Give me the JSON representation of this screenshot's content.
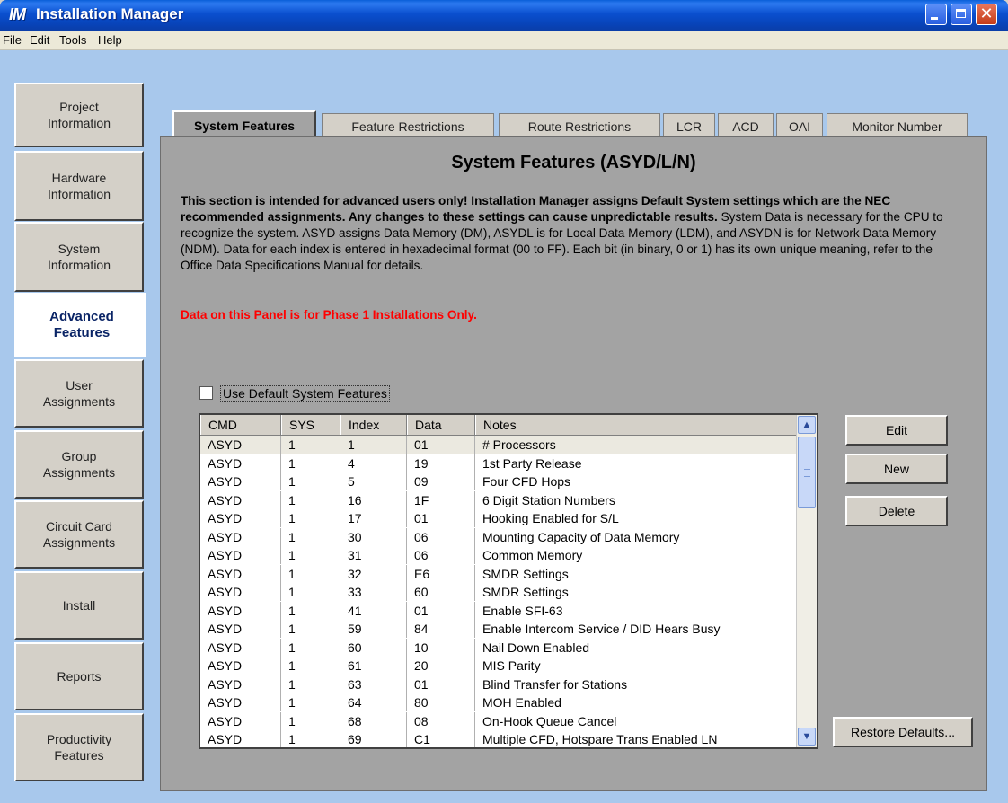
{
  "window": {
    "app_icon": "IM",
    "title": "Installation Manager",
    "buttons": [
      "minimize-icon",
      "maximize-icon",
      "close-icon"
    ]
  },
  "menu": [
    "File",
    "Edit",
    "Tools",
    "Help"
  ],
  "sidebar": {
    "items": [
      {
        "label": "Project\nInformation"
      },
      {
        "label": "Hardware\nInformation"
      },
      {
        "label": "System\nInformation"
      },
      {
        "label": "Advanced\nFeatures",
        "active": true
      },
      {
        "label": "User\nAssignments"
      },
      {
        "label": "Group\nAssignments"
      },
      {
        "label": "Circuit Card\nAssignments"
      },
      {
        "label": "Install"
      },
      {
        "label": "Reports"
      },
      {
        "label": "Productivity\nFeatures"
      }
    ]
  },
  "tabs": [
    {
      "label": "System Features",
      "active": true
    },
    {
      "label": "Feature Restrictions"
    },
    {
      "label": "Route Restrictions"
    },
    {
      "label": "LCR"
    },
    {
      "label": "ACD"
    },
    {
      "label": "OAI"
    },
    {
      "label": "Monitor Number"
    }
  ],
  "panel": {
    "heading": "System Features (ASYD/L/N)",
    "desc_bold": "This section is intended for advanced users only! Installation Manager assigns Default System settings which are the NEC recommended assignments. Any changes to these settings can cause unpredictable results.",
    "desc_normal": " System Data is necessary for the CPU to recognize the system. ASYD assigns Data Memory (DM), ASYDL is for Local Data Memory (LDM), and ASYDN is for Network Data Memory (NDM). Data for each index is entered in hexadecimal format (00 to FF). Each bit (in binary, 0 or 1) has its own unique meaning, refer to the Office Data Specifications Manual for details.",
    "warning": "Data on this Panel is for Phase 1 Installations Only.",
    "checkbox_label": "Use Default System Features",
    "checkbox_checked": false
  },
  "grid": {
    "columns": [
      "CMD",
      "SYS",
      "Index",
      "Data",
      "Notes"
    ],
    "rows": [
      [
        "ASYD",
        "1",
        "1",
        "01",
        "# Processors"
      ],
      [
        "ASYD",
        "1",
        "4",
        "19",
        "1st Party Release"
      ],
      [
        "ASYD",
        "1",
        "5",
        "09",
        "Four CFD Hops"
      ],
      [
        "ASYD",
        "1",
        "16",
        "1F",
        "6 Digit Station Numbers"
      ],
      [
        "ASYD",
        "1",
        "17",
        "01",
        "Hooking Enabled for S/L"
      ],
      [
        "ASYD",
        "1",
        "30",
        "06",
        "Mounting Capacity of Data Memory"
      ],
      [
        "ASYD",
        "1",
        "31",
        "06",
        "Common Memory"
      ],
      [
        "ASYD",
        "1",
        "32",
        "E6",
        "SMDR Settings"
      ],
      [
        "ASYD",
        "1",
        "33",
        "60",
        "SMDR Settings"
      ],
      [
        "ASYD",
        "1",
        "41",
        "01",
        "Enable SFI-63"
      ],
      [
        "ASYD",
        "1",
        "59",
        "84",
        "Enable Intercom Service / DID Hears Busy"
      ],
      [
        "ASYD",
        "1",
        "60",
        "10",
        "Nail Down Enabled"
      ],
      [
        "ASYD",
        "1",
        "61",
        "20",
        "MIS Parity"
      ],
      [
        "ASYD",
        "1",
        "63",
        "01",
        "Blind Transfer for Stations"
      ],
      [
        "ASYD",
        "1",
        "64",
        "80",
        "MOH Enabled"
      ],
      [
        "ASYD",
        "1",
        "68",
        "08",
        "On-Hook Queue Cancel"
      ],
      [
        "ASYD",
        "1",
        "69",
        "C1",
        "Multiple CFD, Hotspare Trans Enabled LN"
      ]
    ],
    "selected_row": 0
  },
  "actions": {
    "edit": "Edit",
    "new": "New",
    "delete": "Delete",
    "restore": "Restore Defaults..."
  },
  "colors": {
    "titlebar": "#0a4fcf",
    "frame": "#a8c8ec",
    "panel": "#a3a3a3",
    "warning": "#ff0000"
  }
}
